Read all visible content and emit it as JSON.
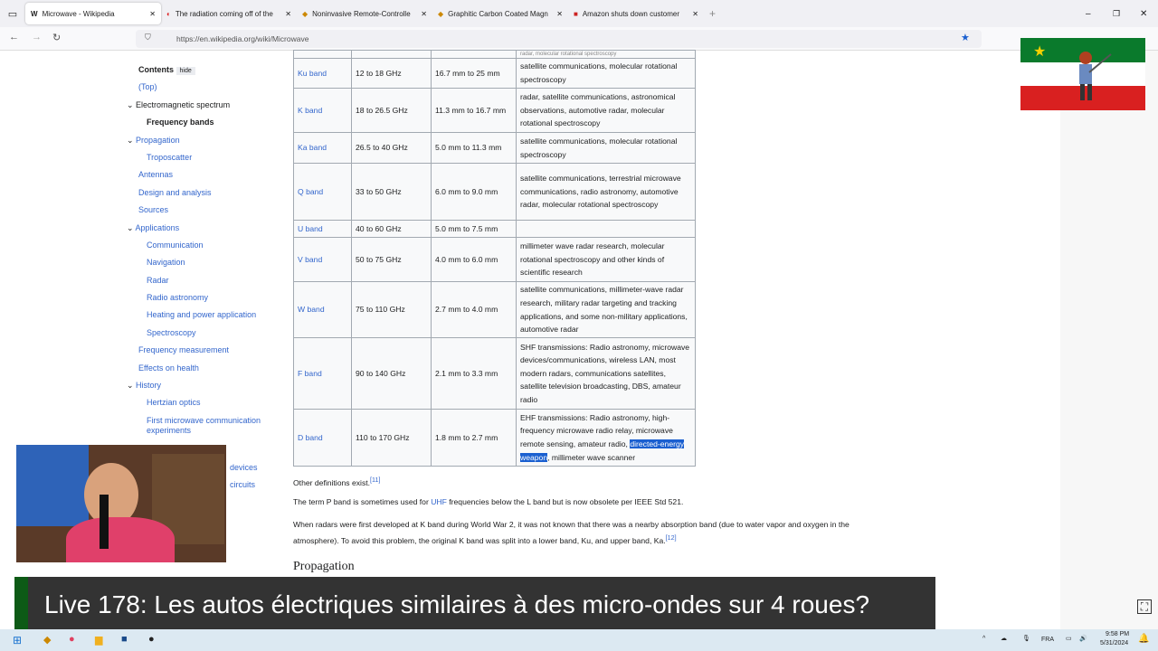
{
  "browser": {
    "tabs": [
      {
        "label": "Microwave - Wikipedia",
        "icon": "W"
      },
      {
        "label": "The radiation coming off of the"
      },
      {
        "label": "Noninvasive Remote-Controlle"
      },
      {
        "label": "Graphitic Carbon Coated Magn"
      },
      {
        "label": "Amazon shuts down customer"
      }
    ],
    "url": "https://en.wikipedia.org/wiki/Microwave"
  },
  "toc": {
    "title": "Contents",
    "hide": "hide",
    "items": [
      "(Top)",
      "Electromagnetic spectrum",
      "Frequency bands",
      "Propagation",
      "Troposcatter",
      "Antennas",
      "Design and analysis",
      "Sources",
      "Applications",
      "Communication",
      "Navigation",
      "Radar",
      "Radio astronomy",
      "Heating and power application",
      "Spectroscopy",
      "Frequency measurement",
      "Effects on health",
      "History",
      "Hertzian optics",
      "First microwave communication experiments"
    ],
    "partial": [
      "devices",
      "circuits"
    ]
  },
  "table": {
    "top_partial": "radar, molecular rotational spectroscopy",
    "rows": [
      [
        "Ku band",
        "12 to 18 GHz",
        "16.7 mm to 25 mm",
        "satellite communications, molecular rotational spectroscopy"
      ],
      [
        "K band",
        "18 to 26.5 GHz",
        "11.3 mm to 16.7 mm",
        "radar, satellite communications, astronomical observations, automotive radar, molecular rotational spectroscopy"
      ],
      [
        "Ka band",
        "26.5 to 40 GHz",
        "5.0 mm to 11.3 mm",
        "satellite communications, molecular rotational spectroscopy"
      ],
      [
        "Q band",
        "33 to 50 GHz",
        "6.0 mm to 9.0 mm",
        "satellite communications, terrestrial microwave communications, radio astronomy, automotive radar, molecular rotational spectroscopy"
      ],
      [
        "U band",
        "40 to 60 GHz",
        "5.0 mm to 7.5 mm",
        ""
      ],
      [
        "V band",
        "50 to 75 GHz",
        "4.0 mm to 6.0 mm",
        "millimeter wave radar research, molecular rotational spectroscopy and other kinds of scientific research"
      ],
      [
        "W band",
        "75 to 110 GHz",
        "2.7 mm to 4.0 mm",
        "satellite communications, millimeter-wave radar research, military radar targeting and tracking applications, and some non-military applications, automotive radar"
      ],
      [
        "F band",
        "90 to 140 GHz",
        "2.1 mm to 3.3 mm",
        "SHF transmissions: Radio astronomy, microwave devices/communications, wireless LAN, most modern radars, communications satellites, satellite television broadcasting, DBS, amateur radio"
      ]
    ],
    "d_row": {
      "band": "D band",
      "freq": "110 to 170 GHz",
      "wave": "1.8 mm to 2.7 mm",
      "use_a": "EHF transmissions: Radio astronomy, high-frequency microwave radio relay, microwave remote sensing, amateur radio, ",
      "use_hl": "directed-energy weapon",
      "use_b": ", millimeter wave scanner"
    }
  },
  "body": {
    "p1": "Other definitions exist.",
    "p1_ref": "[11]",
    "p2_a": "The term P band is sometimes used for ",
    "p2_link": "UHF",
    "p2_b": " frequencies below the L band but is now obsolete per IEEE Std 521.",
    "p3": "When radars were first developed at K band during World War 2, it was not known that there was a nearby absorption band (due to water vapor and oxygen in the atmosphere). To avoid this problem, the original K band was split into a lower band, Ku, and upper band, Ka.",
    "p3_ref": "[12]",
    "h2": "Propagation"
  },
  "overlay": {
    "title": "Live 178: Les autos électriques similaires à des micro-ondes sur 4 roues?"
  },
  "taskbar": {
    "lang": "FRA",
    "time": "9:58 PM",
    "date": "5/31/2024"
  }
}
